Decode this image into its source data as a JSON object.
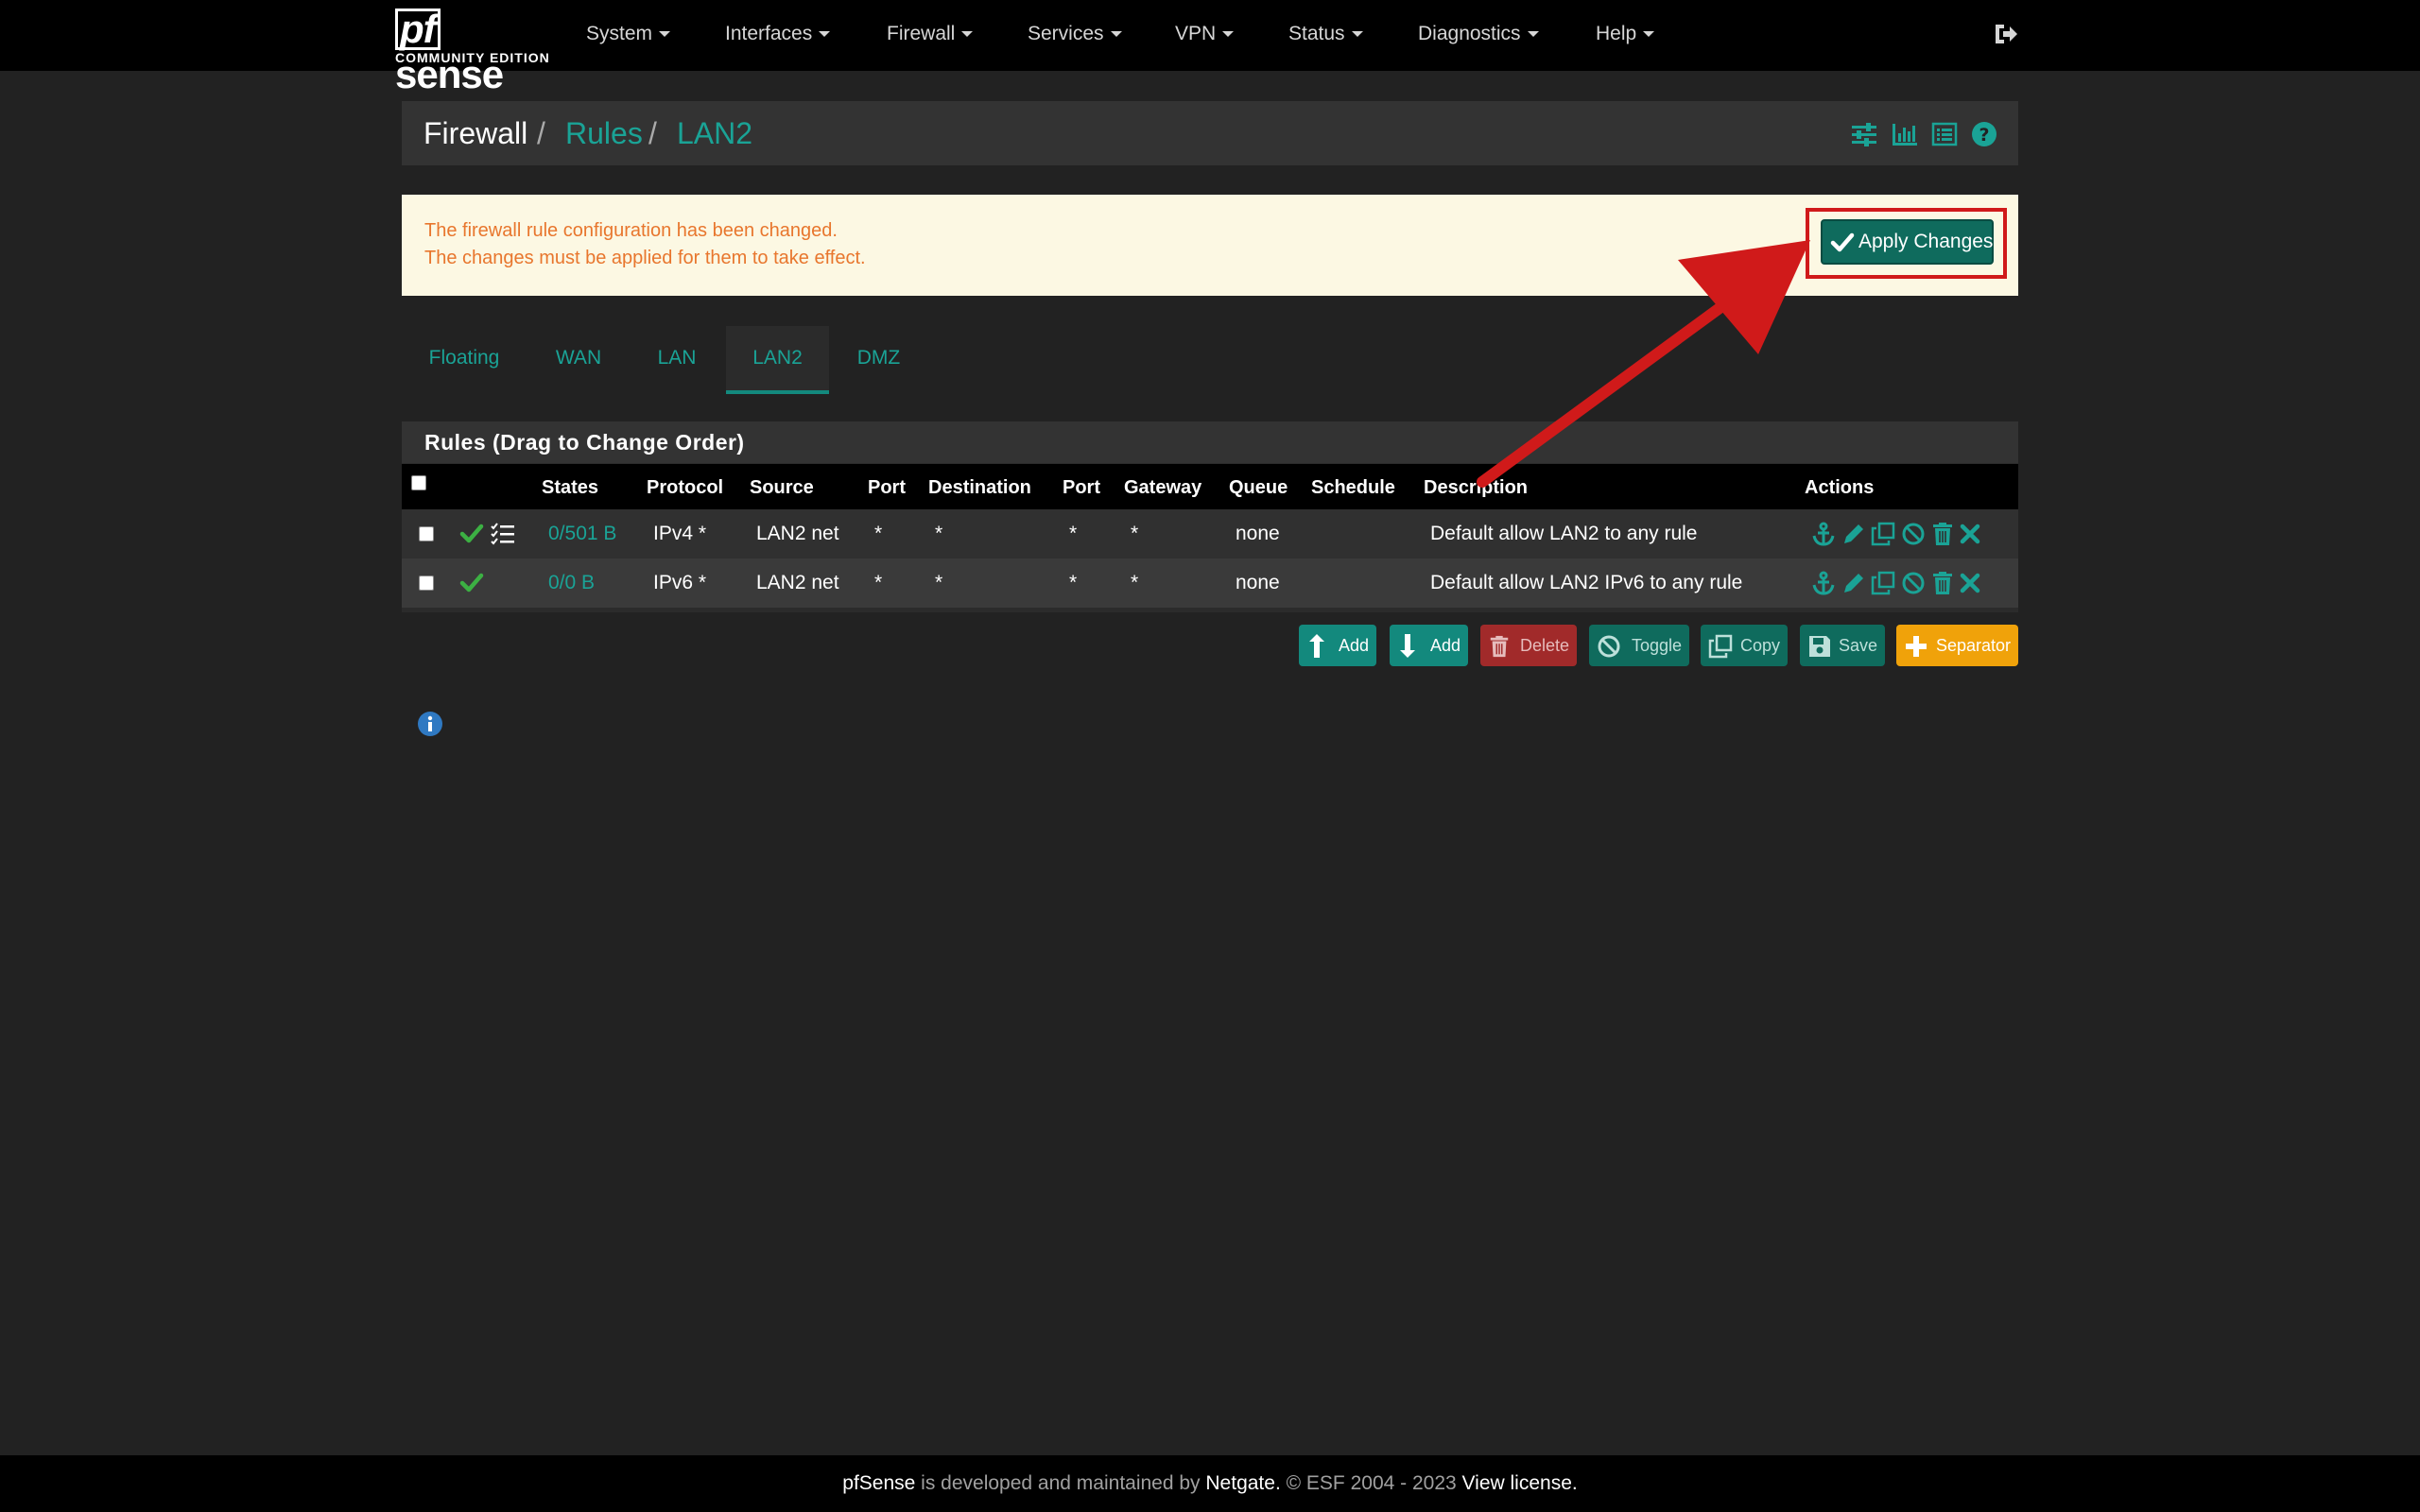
{
  "brand": {
    "name": "pfsense",
    "edition": "COMMUNITY EDITION"
  },
  "nav": {
    "items": [
      {
        "label": "System"
      },
      {
        "label": "Interfaces"
      },
      {
        "label": "Firewall"
      },
      {
        "label": "Services"
      },
      {
        "label": "VPN"
      },
      {
        "label": "Status"
      },
      {
        "label": "Diagnostics"
      },
      {
        "label": "Help"
      }
    ],
    "logout_icon": "sign-out-icon"
  },
  "breadcrumb": {
    "root": "Firewall",
    "sep": "/",
    "section": "Rules",
    "current": "LAN2",
    "icons": [
      "sliders-icon",
      "bar-chart-icon",
      "list-icon",
      "help-icon"
    ]
  },
  "alert": {
    "line1": "The firewall rule configuration has been changed.",
    "line2": "The changes must be applied for them to take effect.",
    "apply_label": "Apply Changes"
  },
  "tabs": [
    {
      "label": "Floating",
      "active": false
    },
    {
      "label": "WAN",
      "active": false
    },
    {
      "label": "LAN",
      "active": false
    },
    {
      "label": "LAN2",
      "active": true
    },
    {
      "label": "DMZ",
      "active": false
    }
  ],
  "rules": {
    "title": "Rules (Drag to Change Order)",
    "columns": [
      "States",
      "Protocol",
      "Source",
      "Port",
      "Destination",
      "Port",
      "Gateway",
      "Queue",
      "Schedule",
      "Description",
      "Actions"
    ],
    "rows": [
      {
        "states": "0/501 B",
        "protocol": "IPv4 *",
        "source": "LAN2 net",
        "sport": "*",
        "destination": "*",
        "dport": "*",
        "gateway": "*",
        "queue": "none",
        "schedule": "",
        "description": "Default allow LAN2 to any rule"
      },
      {
        "states": "0/0 B",
        "protocol": "IPv6 *",
        "source": "LAN2 net",
        "sport": "*",
        "destination": "*",
        "dport": "*",
        "gateway": "*",
        "queue": "none",
        "schedule": "",
        "description": "Default allow LAN2 IPv6 to any rule"
      }
    ],
    "action_icons": [
      "anchor-icon",
      "pencil-icon",
      "copy-icon",
      "ban-icon",
      "trash-icon",
      "times-icon"
    ]
  },
  "buttons": {
    "add_top": "Add",
    "add_bottom": "Add",
    "delete": "Delete",
    "toggle": "Toggle",
    "copy": "Copy",
    "save": "Save",
    "separator": "Separator"
  },
  "footer": {
    "brand": "pfSense",
    "text1": " is developed and maintained by ",
    "company": "Netgate.",
    "text2": " © ESF 2004 - 2023 ",
    "license": "View license."
  },
  "colors": {
    "accent": "#13897d",
    "link": "#1aa396",
    "alert_bg": "#fcf8e3",
    "alert_text": "#e8762d",
    "highlight": "#d01a1a",
    "pass": "#3cb043"
  }
}
